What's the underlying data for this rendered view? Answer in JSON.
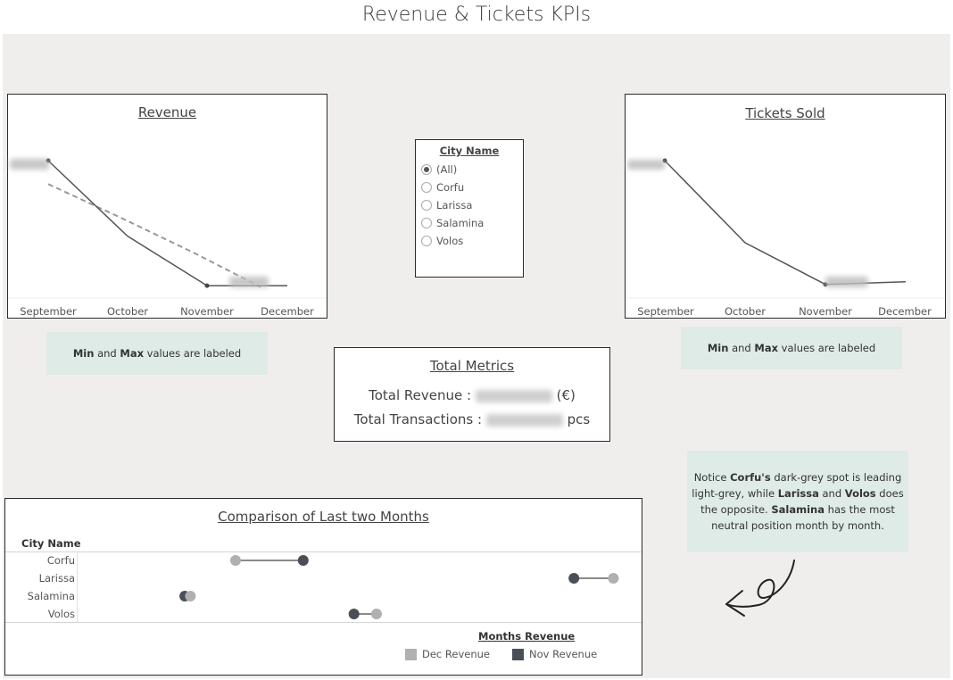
{
  "dashboard_title": "Revenue & Tickets KPIs",
  "revenue_chart": {
    "title": "Revenue",
    "months": [
      "September",
      "October",
      "November",
      "December"
    ],
    "values": [
      1.0,
      0.42,
      0.04,
      0.04
    ],
    "trend_values": [
      0.82,
      0.56,
      0.29,
      0.03
    ],
    "min_label_hidden": true,
    "max_label_hidden": true
  },
  "tickets_chart": {
    "title": "Tickets Sold",
    "months": [
      "September",
      "October",
      "November",
      "December"
    ],
    "values": [
      1.0,
      0.37,
      0.05,
      0.07
    ]
  },
  "city_filter": {
    "title": "City Name",
    "options": [
      "(All)",
      "Corfu",
      "Larissa",
      "Salamina",
      "Volos"
    ],
    "selected": "(All)"
  },
  "notes": {
    "revenue_note_pre": "Min",
    "revenue_note_mid": " and ",
    "revenue_note_b": "Max",
    "revenue_note_post": " values are labeled",
    "tickets_note_pre": "Min",
    "tickets_note_mid": " and ",
    "tickets_note_b": "Max",
    "tickets_note_post": " values are labeled",
    "insight": {
      "p1": "Notice ",
      "b1": "Corfu's",
      "p2": " dark-grey spot is leading light-grey, while ",
      "b2": "Larissa",
      "p3": " and ",
      "b3": "Volos",
      "p4": " does the opposite. ",
      "b4": "Salamina",
      "p5": " has the most neutral position month by month."
    }
  },
  "total_metrics": {
    "title": "Total Metrics",
    "revenue_label": "Total Revenue :",
    "revenue_unit": "(€)",
    "transactions_label": "Total Transactions :",
    "transactions_unit": "pcs"
  },
  "comparison": {
    "title": "Comparison of Last two Months",
    "row_header": "City Name",
    "cities": [
      "Corfu",
      "Larissa",
      "Salamina",
      "Volos"
    ],
    "dec_positions": [
      0.28,
      0.95,
      0.2,
      0.53
    ],
    "nov_positions": [
      0.4,
      0.88,
      0.19,
      0.49
    ],
    "legend_title": "Months Revenue",
    "legend": [
      {
        "label": "Dec Revenue",
        "color": "#b0b0b0"
      },
      {
        "label": "Nov Revenue",
        "color": "#4a4f57"
      }
    ]
  },
  "colors": {
    "canvas": "#f0eeed",
    "note_bg": "#deebe7",
    "line": "#555555",
    "trend": "#999999",
    "dec": "#b0b0b0",
    "nov": "#4a4f57"
  }
}
